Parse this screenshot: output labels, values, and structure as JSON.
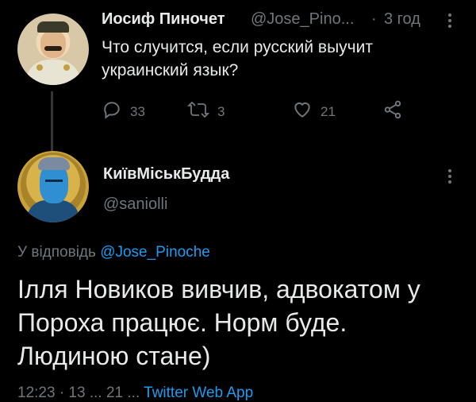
{
  "tweet1": {
    "author_name": "Иосиф Пиночет",
    "handle": "@Jose_Pino...",
    "separator": "·",
    "time": "3 год",
    "text": "Что случится, если русский выучит украинский язык?",
    "actions": {
      "reply_count": "33",
      "retweet_count": "3",
      "like_count": "21"
    }
  },
  "tweet2": {
    "author_name": "КиївМіськБудда",
    "handle": "@saniolli",
    "reply_prefix": "У відповідь",
    "reply_mention": "@Jose_Pinoche",
    "text": "Ілля Новиков вивчив, адвокатом у Пороха працює. Норм буде. Людиною стане)",
    "meta_time": "12:23 · 13 ...",
    "meta_count": "21 ...",
    "meta_source": "Twitter Web App"
  },
  "colors": {
    "background": "#000000",
    "text_primary": "#e7e9ea",
    "text_secondary": "#71767b",
    "accent": "#1d9bf0",
    "thread_line": "#333639"
  },
  "icons": [
    "more-icon",
    "reply-icon",
    "retweet-icon",
    "like-icon",
    "share-icon"
  ]
}
